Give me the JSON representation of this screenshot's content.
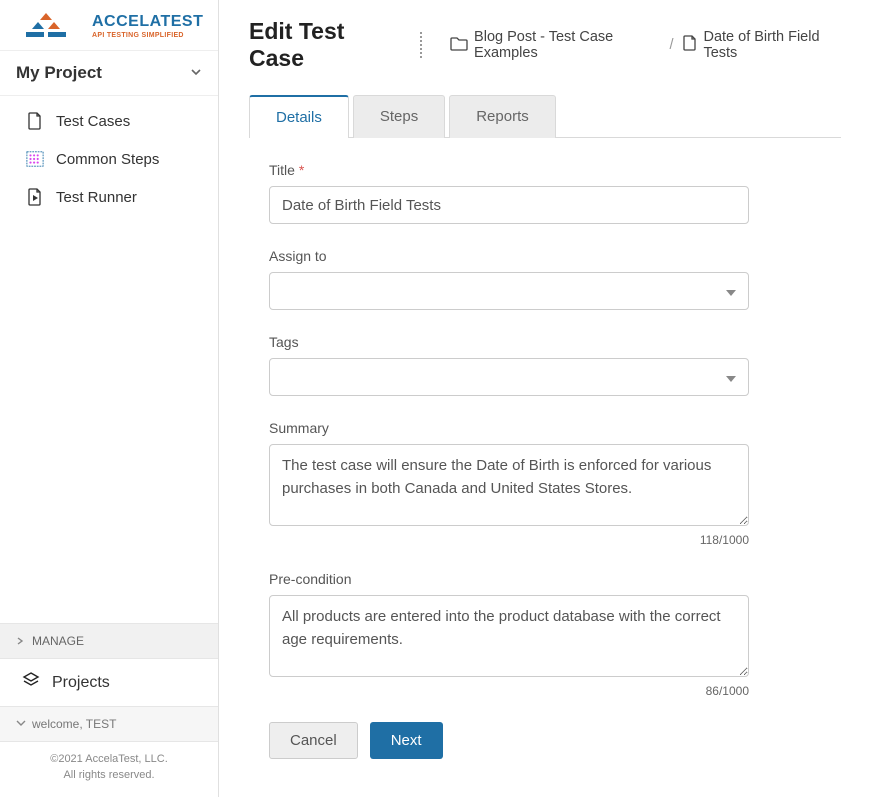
{
  "brand": {
    "name": "ACCELATEST",
    "tagline": "API TESTING SIMPLIFIED"
  },
  "sidebar": {
    "project_label": "My Project",
    "items": [
      {
        "label": "Test Cases",
        "icon": "file-icon"
      },
      {
        "label": "Common Steps",
        "icon": "grid-icon"
      },
      {
        "label": "Test Runner",
        "icon": "file-play-icon"
      }
    ],
    "manage_label": "MANAGE",
    "projects_label": "Projects",
    "welcome_label": "welcome, TEST",
    "footer_line1": "©2021 AccelaTest, LLC.",
    "footer_line2": "All rights reserved."
  },
  "header": {
    "title": "Edit Test Case",
    "breadcrumb": [
      {
        "label": "Blog Post - Test Case Examples",
        "icon": "folder-icon"
      },
      {
        "label": "Date of Birth Field Tests",
        "icon": "file-icon"
      }
    ]
  },
  "tabs": [
    {
      "label": "Details",
      "active": true
    },
    {
      "label": "Steps",
      "active": false
    },
    {
      "label": "Reports",
      "active": false
    }
  ],
  "form": {
    "title_label": "Title",
    "title_value": "Date of Birth Field Tests",
    "assign_label": "Assign to",
    "assign_value": "",
    "tags_label": "Tags",
    "tags_value": "",
    "summary_label": "Summary",
    "summary_value": "The test case will ensure the Date of Birth is enforced for various purchases in both Canada and United States Stores.",
    "summary_count": "118/1000",
    "precondition_label": "Pre-condition",
    "precondition_value": "All products are entered into the product database with the correct age requirements.",
    "precondition_count": "86/1000",
    "cancel_label": "Cancel",
    "next_label": "Next"
  }
}
